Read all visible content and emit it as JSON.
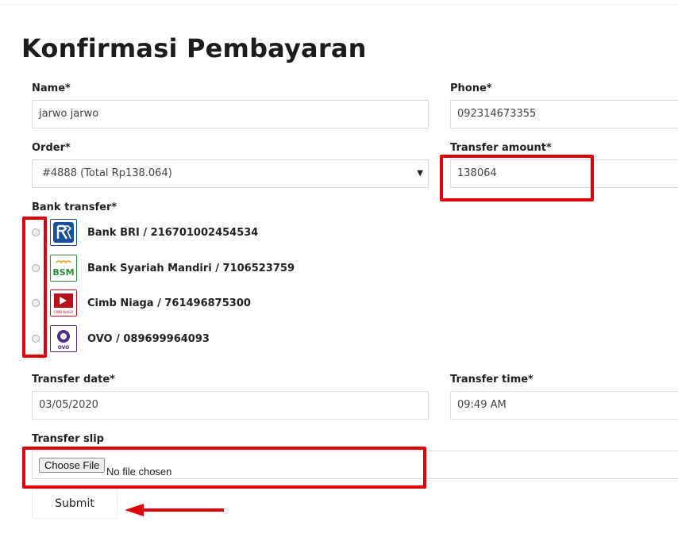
{
  "page": {
    "title": "Konfirmasi Pembayaran"
  },
  "form": {
    "name": {
      "label": "Name*",
      "value": "jarwo jarwo"
    },
    "phone": {
      "label": "Phone*",
      "value": "092314673355"
    },
    "order": {
      "label": "Order*",
      "value": "#4888 (Total Rp138.064)"
    },
    "transfer_amount": {
      "label": "Transfer amount*",
      "value": "138064"
    },
    "bank_transfer": {
      "label": "Bank transfer*",
      "options": [
        {
          "label": "Bank BRI / 216701002454534",
          "icon": "bri-logo-icon",
          "selected": false
        },
        {
          "label": "Bank Syariah Mandiri / 7106523759",
          "icon": "bsm-logo-icon",
          "logo_text": "BSM",
          "selected": false
        },
        {
          "label": "Cimb Niaga / 761496875300",
          "icon": "cimb-niaga-logo-icon",
          "logo_text": "CIMB NIAGA",
          "selected": false
        },
        {
          "label": "OVO / 089699964093",
          "icon": "ovo-logo-icon",
          "logo_text": "OVO",
          "selected": false
        }
      ]
    },
    "transfer_date": {
      "label": "Transfer date*",
      "value": "03/05/2020"
    },
    "transfer_time": {
      "label": "Transfer time*",
      "value": "09:49 AM"
    },
    "transfer_slip": {
      "label": "Transfer slip",
      "button_label": "Choose File",
      "status": "No file chosen"
    },
    "submit_label": "Submit"
  },
  "colors": {
    "highlight": "#e0000a",
    "bri": "#1a4f9c",
    "bsm": "#2e8b3a",
    "cimb": "#b5121b",
    "ovo": "#4c2a86"
  }
}
